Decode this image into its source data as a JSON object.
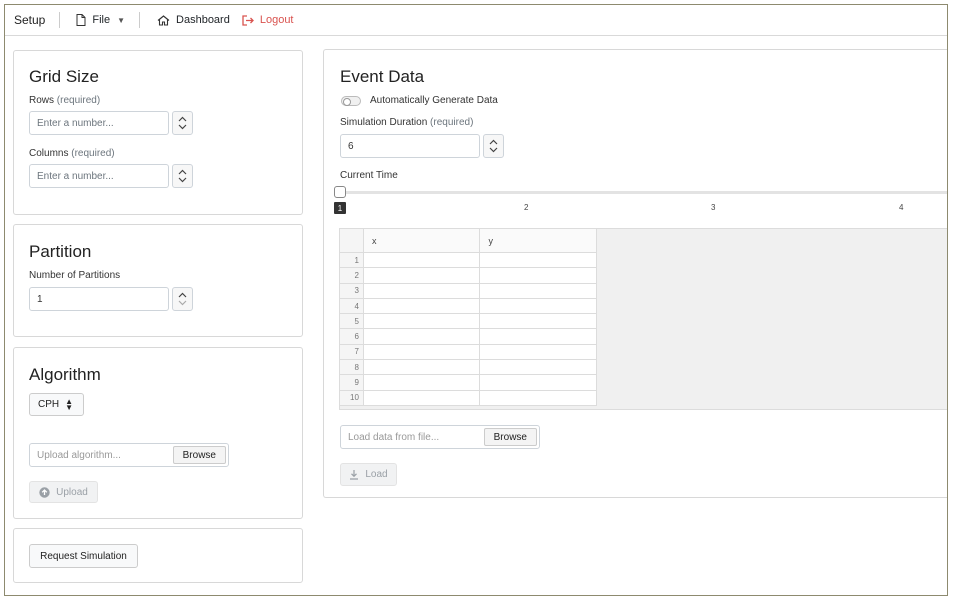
{
  "nav": {
    "setup": "Setup",
    "file": "File",
    "dashboard": "Dashboard",
    "logout": "Logout",
    "logout_color": "#d9534f"
  },
  "grid_size": {
    "title": "Grid Size",
    "rows_label": "Rows",
    "rows_req": "(required)",
    "rows_placeholder": "Enter a number...",
    "cols_label": "Columns",
    "cols_req": "(required)",
    "cols_placeholder": "Enter a number..."
  },
  "partition": {
    "title": "Partition",
    "label": "Number of Partitions",
    "value": "1"
  },
  "algorithm": {
    "title": "Algorithm",
    "selected": "CPH",
    "upload_placeholder": "Upload algorithm...",
    "browse": "Browse",
    "upload_button": "Upload"
  },
  "request": {
    "button": "Request Simulation"
  },
  "event_data": {
    "title": "Event Data",
    "auto_generate": "Automatically Generate Data",
    "duration_label": "Simulation Duration",
    "duration_req": "(required)",
    "duration_value": "6",
    "current_time_label": "Current Time",
    "current_time_value": "1",
    "ticks": [
      "2",
      "3",
      "4"
    ],
    "table": {
      "columns": [
        "x",
        "y"
      ],
      "row_numbers": [
        "1",
        "2",
        "3",
        "4",
        "5",
        "6",
        "7",
        "8",
        "9",
        "10"
      ]
    },
    "load_placeholder": "Load data from file...",
    "browse": "Browse",
    "load_button": "Load"
  }
}
